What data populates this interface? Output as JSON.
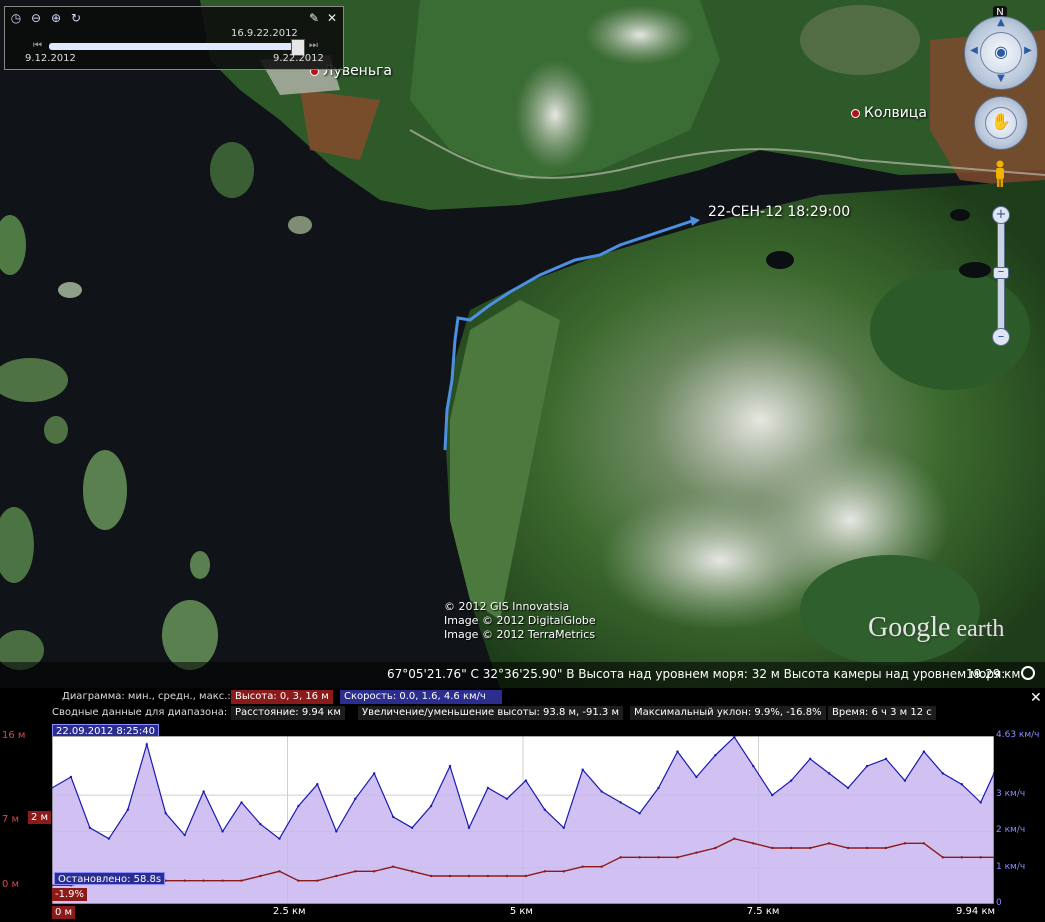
{
  "map": {
    "places": [
      {
        "name": "Лувеньга"
      },
      {
        "name": "Колвица"
      }
    ],
    "track_label": "22-СЕН-12 18:29:00",
    "copyright": [
      "© 2012 GIS Innovatsia",
      "Image © 2012 DigitalGlobe",
      "Image © 2012 TerraMetrics"
    ],
    "logo_main": "Google",
    "logo_sub": " earth",
    "status": {
      "coords": "67°05'21.76\" С   32°36'25.90\" В  Высота над уровнем моря:  32 м  Высота камеры над уровнем моря:",
      "eye_alt": "19.29 км"
    },
    "north_label": "N",
    "icons": {
      "compass": "look-ring-eye-icon",
      "move": "move-ring-hand-icon",
      "zoom_in": "zoom-in-icon",
      "zoom_out": "zoom-out-icon",
      "street_view": "pegman-icon"
    }
  },
  "timeslider": {
    "current": "16.9.22.2012",
    "start": "9.12.2012",
    "end": "9.22.2012",
    "progress": 0.96,
    "buttons": [
      "clock-icon",
      "zoom-out-time-icon",
      "zoom-in-time-icon",
      "play-icon",
      "settings-wrench-icon",
      "close-icon"
    ]
  },
  "profile": {
    "row1_label": "Диаграмма: мин., средн., макс.:",
    "height_stat": "Высота: 0, 3, 16 м",
    "speed_stat": "Скорость: 0.0, 1.6, 4.6 км/ч",
    "row2_label": "Сводные данные для диапазона:",
    "distance": "Расстояние: 9.94 км",
    "elev_gain": "Увеличение/уменьшение высоты: 93.8 м, -91.3 м",
    "max_slope": "Максимальный уклон: 9.9%, -16.8%",
    "time": "Время: 6 ч 3 м 12 с",
    "start_stamp": "22.09.2012 8:25:40",
    "stopped": "Остановлено: 58.8s",
    "slope_tag": "-1.9%",
    "cursor_alt_tag": "2 м",
    "zero_tag": "0 м",
    "colors": {
      "height": "#8b1a1a",
      "speed": "#1b1bb0",
      "fill_speed": "#c8b6f0",
      "stop": "#f4b9b4"
    }
  },
  "chart_data": {
    "type": "line",
    "x": [
      0,
      0.2,
      0.4,
      0.6,
      0.8,
      1.0,
      1.2,
      1.4,
      1.6,
      1.8,
      2.0,
      2.2,
      2.4,
      2.6,
      2.8,
      3.0,
      3.2,
      3.4,
      3.6,
      3.8,
      4.0,
      4.2,
      4.4,
      4.6,
      4.8,
      5.0,
      5.2,
      5.4,
      5.6,
      5.8,
      6.0,
      6.2,
      6.4,
      6.6,
      6.8,
      7.0,
      7.2,
      7.4,
      7.6,
      7.8,
      8.0,
      8.2,
      8.4,
      8.6,
      8.8,
      9.0,
      9.2,
      9.4,
      9.6,
      9.8,
      9.94
    ],
    "series": [
      {
        "name": "Высота",
        "unit": "м",
        "axis": "left",
        "values": [
          0,
          0,
          0.5,
          0.5,
          0.5,
          0.5,
          0.5,
          0.5,
          0.5,
          0.5,
          0.5,
          1,
          1.5,
          0.5,
          0.5,
          1,
          1.5,
          1.5,
          2,
          1.5,
          1,
          1,
          1,
          1,
          1,
          1,
          1.5,
          1.5,
          2,
          2,
          3,
          3,
          3,
          3,
          3.5,
          4,
          5,
          4.5,
          4,
          4,
          4,
          4.5,
          4,
          4,
          4,
          4.5,
          4.5,
          3,
          3,
          3,
          3
        ]
      },
      {
        "name": "Скорость",
        "unit": "км/ч",
        "axis": "right",
        "values": [
          3.2,
          3.5,
          2.1,
          1.8,
          2.6,
          4.4,
          2.5,
          1.9,
          3.1,
          2.0,
          2.8,
          2.2,
          1.8,
          2.7,
          3.3,
          2.0,
          2.9,
          3.6,
          2.4,
          2.1,
          2.7,
          3.8,
          2.1,
          3.2,
          2.9,
          3.4,
          2.6,
          2.1,
          3.7,
          3.1,
          2.8,
          2.5,
          3.2,
          4.2,
          3.5,
          4.1,
          4.6,
          3.8,
          3.0,
          3.4,
          4.0,
          3.6,
          3.2,
          3.8,
          4.0,
          3.4,
          4.2,
          3.6,
          3.3,
          2.8,
          3.6
        ]
      }
    ],
    "xticks": [
      "2.5 км",
      "5 км",
      "7.5 км",
      "9.94 км"
    ],
    "yticks_left": [
      "16 м",
      "7 м",
      "0 м"
    ],
    "yticks_right": [
      "4.63 км/ч",
      "3 км/ч",
      "2 км/ч",
      "1 км/ч",
      "0"
    ],
    "ylim_left": [
      -2,
      16
    ],
    "ylim_right": [
      0,
      4.63
    ],
    "xlim": [
      0,
      9.94
    ],
    "grid": true
  }
}
